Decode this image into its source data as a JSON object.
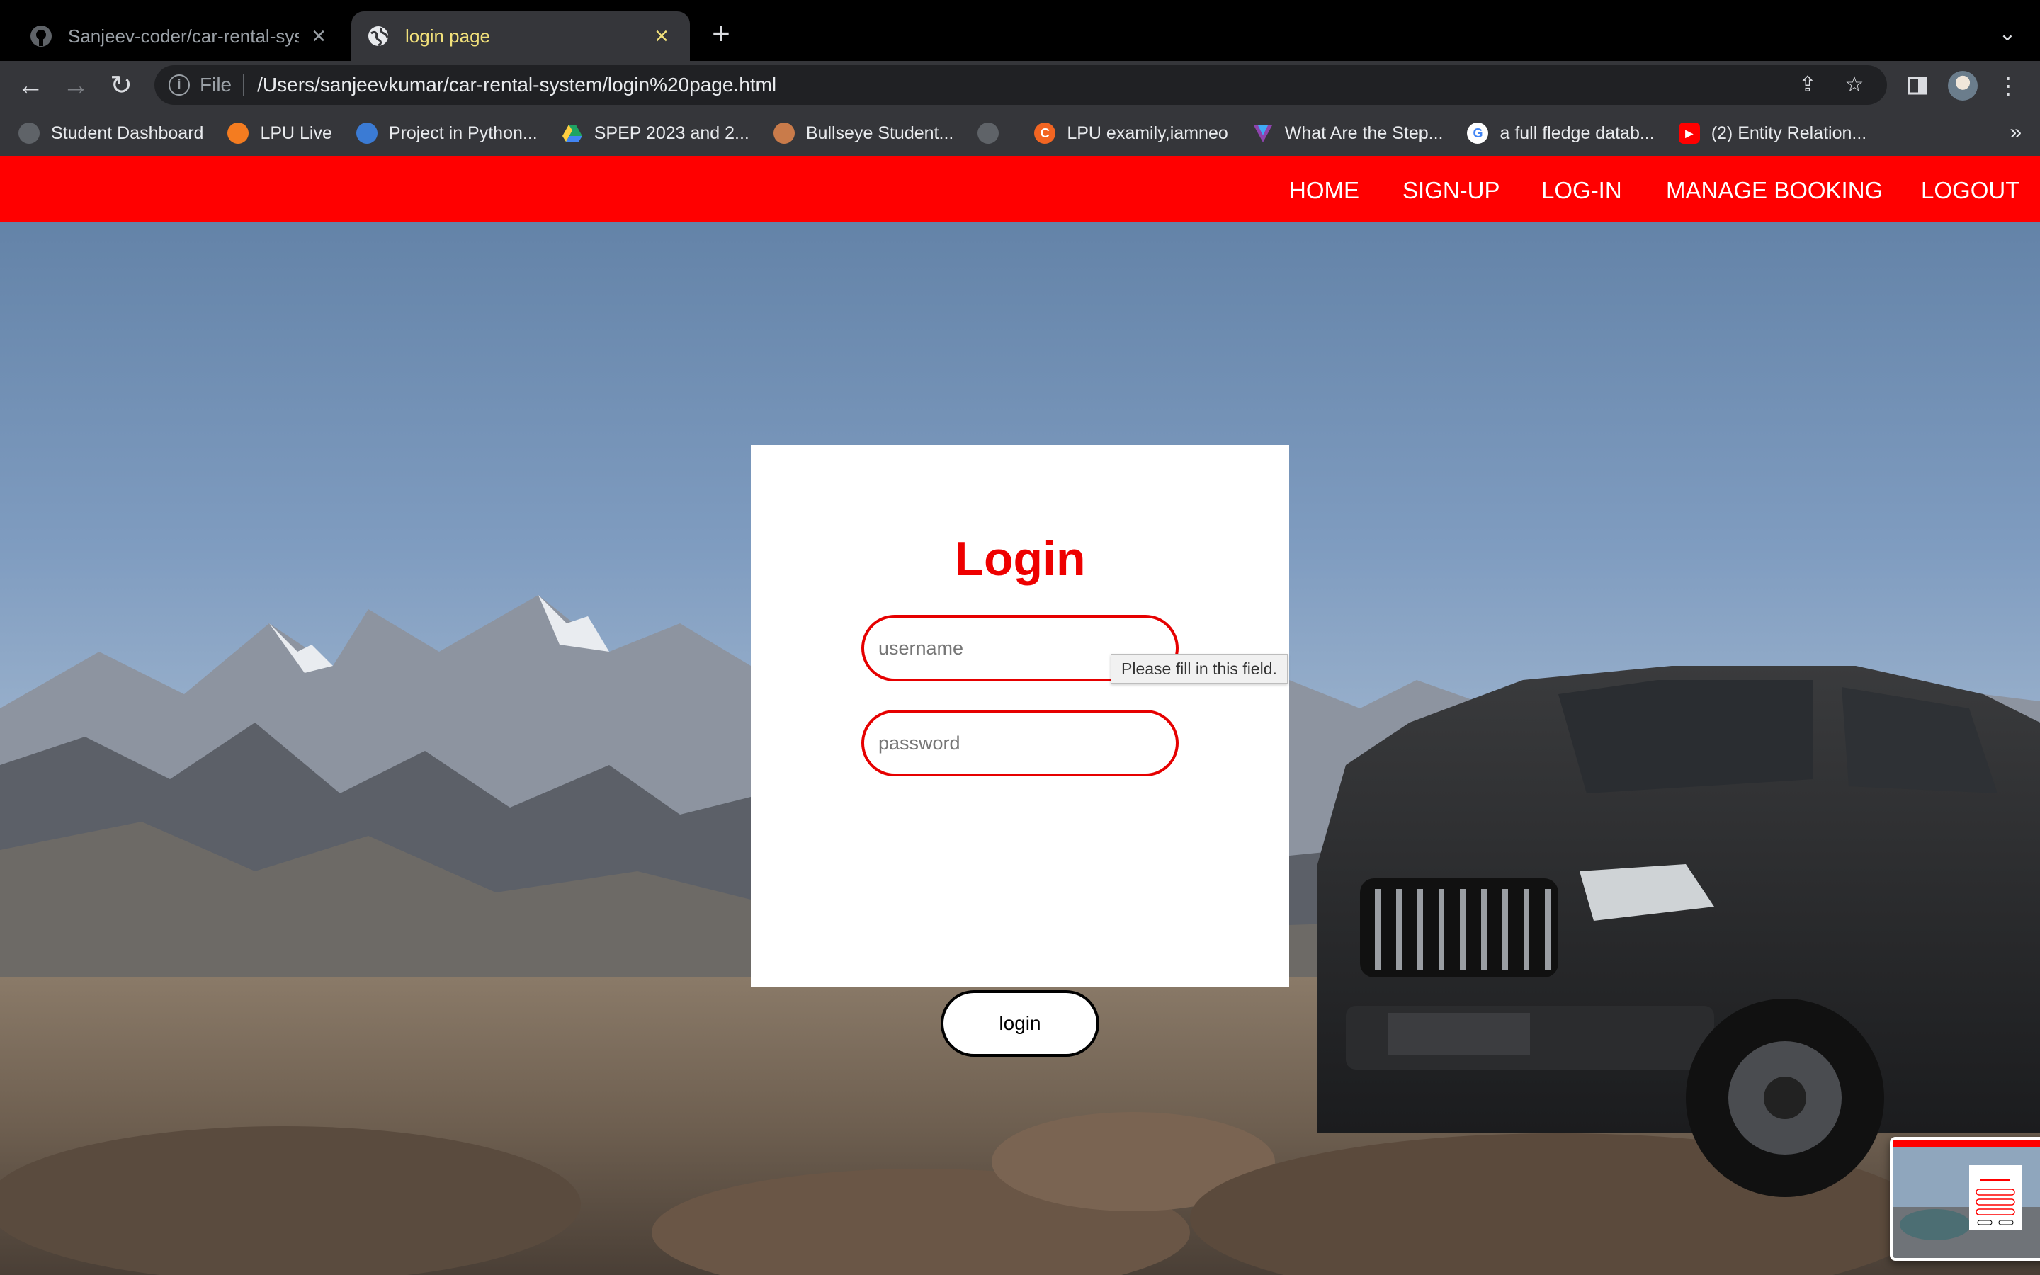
{
  "browser": {
    "tabs": [
      {
        "title": "Sanjeev-coder/car-rental-syst",
        "icon": "github-icon",
        "active": false
      },
      {
        "title": "login page",
        "icon": "globe-icon",
        "active": true
      }
    ],
    "url_scheme": "File",
    "url": "/Users/sanjeevkumar/car-rental-system/login%20page.html",
    "bookmarks": [
      {
        "label": "Student Dashboard",
        "icon": "globe-icon",
        "color": "#5f6368"
      },
      {
        "label": "LPU Live",
        "icon": "lpu-live-icon",
        "color": "#f47c20"
      },
      {
        "label": "Project in Python...",
        "icon": "python-project-icon",
        "color": "#3b7bd4"
      },
      {
        "label": "SPEP 2023 and 2...",
        "icon": "google-drive-icon",
        "color": "#1fa463"
      },
      {
        "label": "Bullseye Student...",
        "icon": "bullseye-icon",
        "color": "#c97b4a"
      },
      {
        "label": "",
        "icon": "globe-icon",
        "color": "#5f6368"
      },
      {
        "label": "LPU examily,iamneo",
        "icon": "examly-icon",
        "color": "#f26522"
      },
      {
        "label": "What Are the Step...",
        "icon": "vee-icon",
        "color": "#8e44ad"
      },
      {
        "label": "a full fledge datab...",
        "icon": "google-icon",
        "color": "#ffffff"
      },
      {
        "label": "(2) Entity Relation...",
        "icon": "youtube-icon",
        "color": "#ff0000"
      }
    ]
  },
  "site": {
    "nav": [
      "HOME",
      "SIGN-UP",
      "LOG-IN",
      "MANAGE BOOKING",
      "LOGOUT"
    ],
    "accent": "#ff0000"
  },
  "login": {
    "title": "Login",
    "username_placeholder": "username",
    "password_placeholder": "password",
    "button_label": "login",
    "validation_tooltip": "Please fill in this field."
  }
}
